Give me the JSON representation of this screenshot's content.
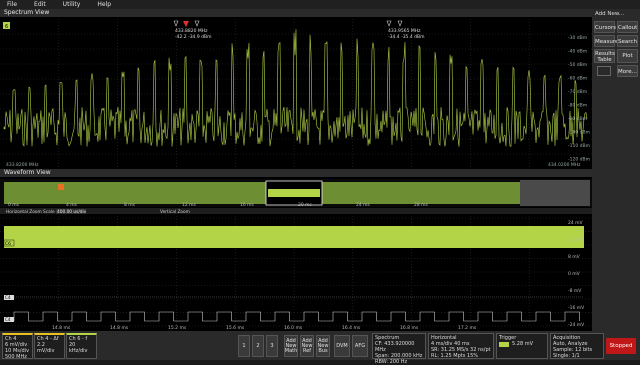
{
  "menu": [
    "File",
    "Edit",
    "Utility",
    "Help"
  ],
  "spectrum": {
    "title": "Spectrum View",
    "ch_label": "6",
    "left_freq": "433.8200 MHz",
    "right_freq": "434.0200 MHz",
    "marker1": "433.8820 MHz",
    "marker1_val": "-42.2   -34.9 dBm",
    "marker2": "433.9565 MHz",
    "marker2_val": "-34.4   -35.4 dBm",
    "y_labels": [
      "-30 dBm",
      "-40 dBm",
      "-50 dBm",
      "-60 dBm",
      "-70 dBm",
      "-80 dBm",
      "-90 dBm",
      "-100 dBm",
      "-110 dBm",
      "-120 dBm"
    ]
  },
  "waveform": {
    "title": "Waveform View",
    "zoom_label": "Horizontal Zoom Scale",
    "zoom_value": "400.00 us/div",
    "pos_label": "Vertical Zoom",
    "ch4": "C4",
    "ch6": "C6",
    "zoom_ticks": [
      "0 ms",
      "4 ms",
      "8 ms",
      "12 ms",
      "16 ms",
      "20 ms",
      "24 ms",
      "28 ms"
    ],
    "bottom_ticks": [
      "14.8 ms",
      "14.8 ms",
      "15.2 ms",
      "15.6 ms",
      "16.0 ms",
      "16.4 ms",
      "16.8 ms",
      "17.2 ms"
    ],
    "right_labels": [
      "24 mV",
      "",
      "16 mV",
      "",
      "8 mV",
      "",
      "0 mV",
      "",
      "-8 mV",
      "",
      "-16 mV",
      "",
      "-24 mV"
    ]
  },
  "sidebar": {
    "title": "Add New...",
    "buttons": [
      "Cursors",
      "Callout",
      "Measure",
      "Search",
      "Results Table",
      "Plot",
      "More..."
    ]
  },
  "bottom": {
    "ch4": {
      "name": "Ch 4",
      "l1": "6 mV/div",
      "l2": "10 Ms/div",
      "l3": "500 MHz"
    },
    "ch4b": {
      "name": "Ch 4 - Δf",
      "l1": "2.2 mV/div",
      "l2": "",
      "l3": ""
    },
    "ch6": {
      "name": "Ch 6 - f",
      "l1": "20 kHz/div",
      "l2": "",
      "l3": ""
    },
    "buttons": [
      "1",
      "2",
      "3",
      "Add New Math",
      "Add New Ref",
      "Add New Bus",
      "DVM",
      "AFG"
    ],
    "spectrum": {
      "name": "Spectrum",
      "l1": "CF: 433.920000 MHz",
      "l2": "Span: 200.000 kHz",
      "l3": "RBW: 200 Hz"
    },
    "horizontal": {
      "name": "Horizontal",
      "l1": "4 ms/div    40 ms",
      "l2": "SR: 31.25 MS/s  32 ns/pt",
      "l3": "RL: 1.25 Mpts  15%"
    },
    "trigger": {
      "name": "Trigger",
      "l1": "5.28 mV",
      "l2": "",
      "": ""
    },
    "acquisition": {
      "name": "Acquisition",
      "l1": "Auto,    Analyze",
      "l2": "Sample: 12 bits",
      "l3": "Single: 1/1"
    },
    "stopped": "Stopped"
  },
  "colors": {
    "trace": "#b4d448",
    "stopped": "#c01818"
  }
}
